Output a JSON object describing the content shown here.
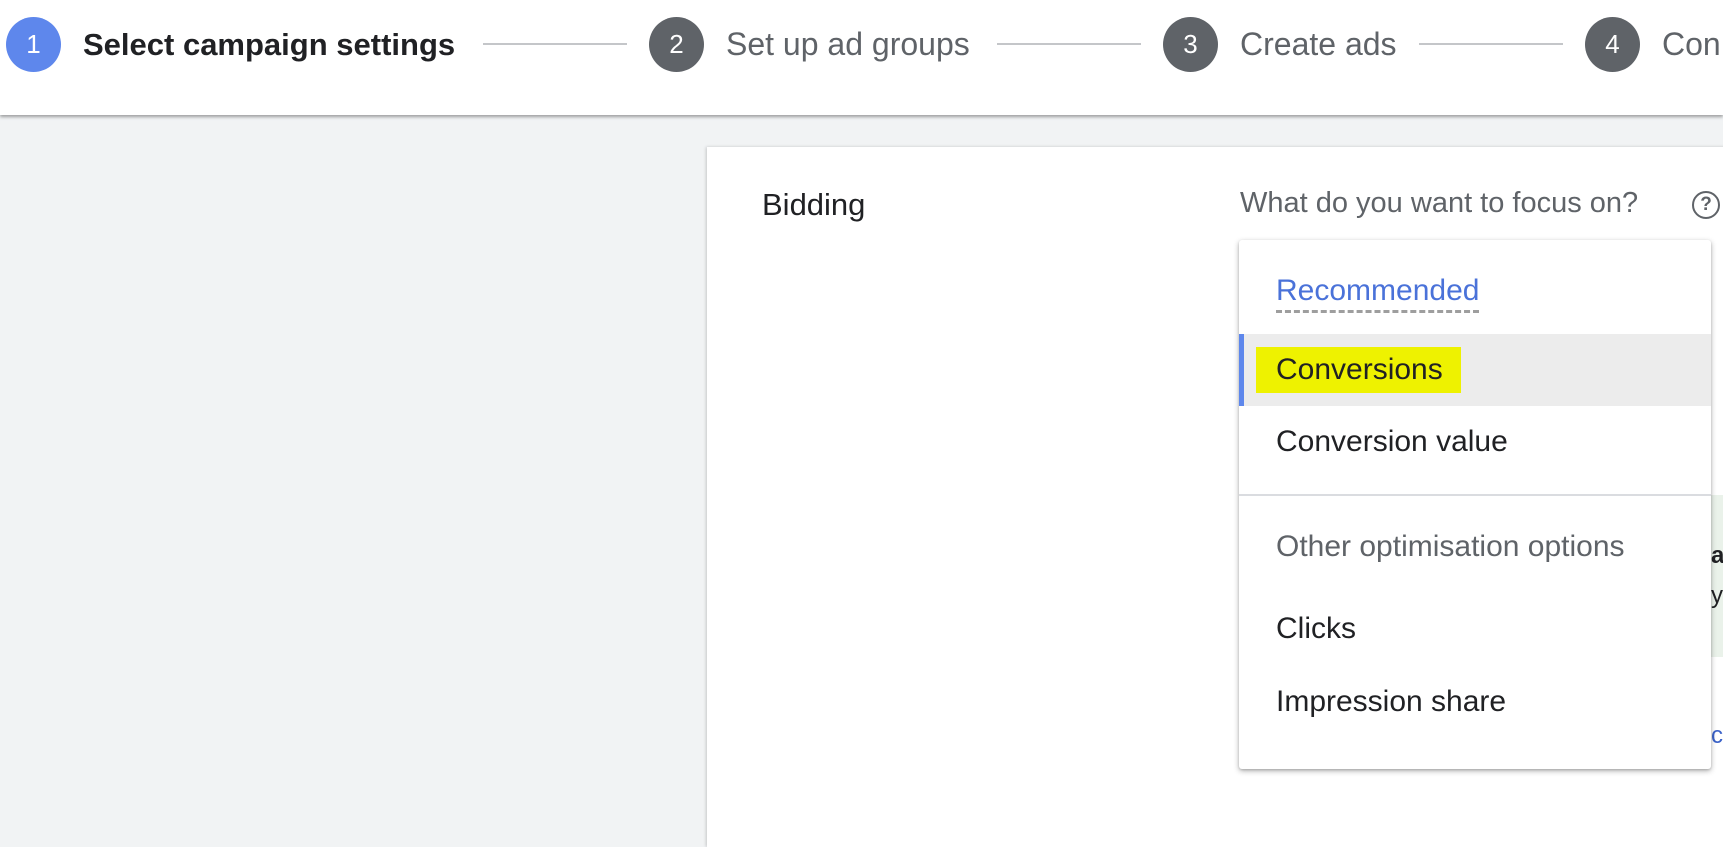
{
  "stepper": {
    "steps": [
      {
        "number": "1",
        "label": "Select campaign settings",
        "state": "active"
      },
      {
        "number": "2",
        "label": "Set up ad groups",
        "state": "inactive"
      },
      {
        "number": "3",
        "label": "Create ads",
        "state": "inactive"
      },
      {
        "number": "4",
        "label": "Con",
        "state": "inactive"
      }
    ]
  },
  "card": {
    "section_title": "Bidding",
    "focus_question": "What do you want to focus on?",
    "help_icon": "help-circle-icon",
    "help_glyph": "?"
  },
  "dropdown": {
    "recommended_header": "Recommended",
    "recommended_options": [
      {
        "label": "Conversions",
        "selected": true,
        "highlighted": true
      },
      {
        "label": "Conversion value",
        "selected": false
      }
    ],
    "other_header": "Other optimisation options",
    "other_options": [
      {
        "label": "Clicks"
      },
      {
        "label": "Impression share"
      }
    ]
  },
  "behind": {
    "partial_bold": "a",
    "partial_text": "y",
    "partial_link": "c"
  },
  "colors": {
    "accent": "#5e87ec",
    "highlight": "#eef200",
    "recommended_text": "#4a72d9",
    "inactive_step": "#5f6368",
    "background": "#f1f3f4"
  }
}
